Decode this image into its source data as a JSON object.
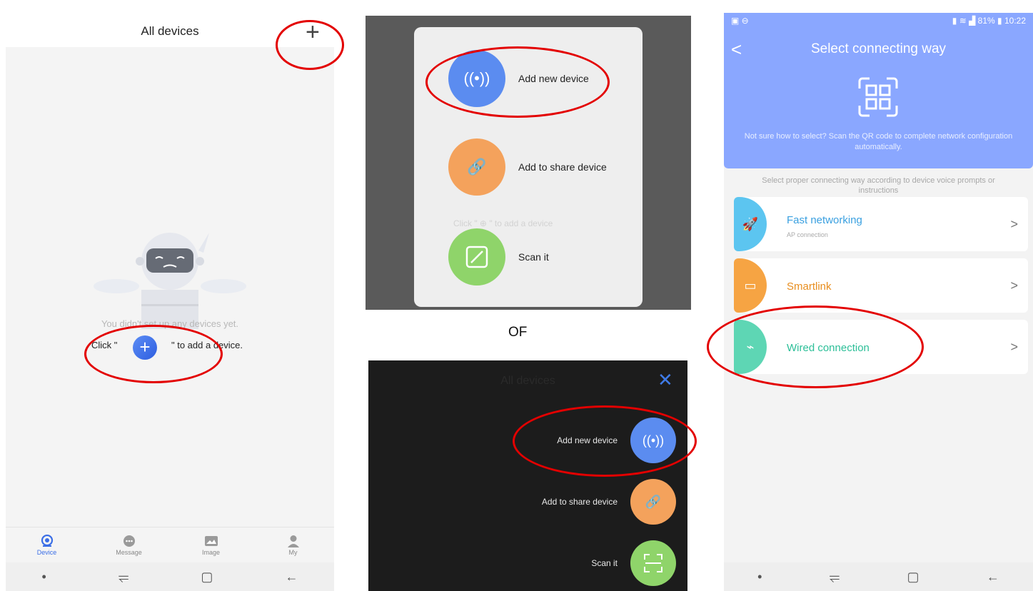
{
  "panel1": {
    "title": "All devices",
    "add_icon": "plus-icon",
    "empty_text": "You didn't set up any devices yet.",
    "click_prefix": "Click \"",
    "click_suffix": "\" to add a device.",
    "tabs": [
      {
        "label": "Device",
        "icon": "camera-icon",
        "active": true
      },
      {
        "label": "Message",
        "icon": "message-icon",
        "active": false
      },
      {
        "label": "Image",
        "icon": "image-icon",
        "active": false
      },
      {
        "label": "My",
        "icon": "user-icon",
        "active": false
      }
    ]
  },
  "panel2": {
    "options": [
      {
        "label": "Add new device",
        "icon": "wireless-icon",
        "color": "#5b8cf0"
      },
      {
        "label": "Add to share device",
        "icon": "link-icon",
        "color": "#f4a25c"
      },
      {
        "label": "Scan it",
        "icon": "scan-icon",
        "color": "#8fd46a"
      }
    ]
  },
  "of_label": "OF",
  "panel3": {
    "title": "All devices",
    "close_icon": "close-icon",
    "options": [
      {
        "label": "Add new device",
        "icon": "wireless-icon",
        "color": "#5b8cf0"
      },
      {
        "label": "Add to share device",
        "icon": "link-icon",
        "color": "#f4a25c"
      },
      {
        "label": "Scan it",
        "icon": "scan-icon",
        "color": "#8fd46a"
      }
    ]
  },
  "panel4": {
    "status_battery": "81%",
    "status_time": "10:22",
    "title": "Select connecting way",
    "hint": "Not sure how to select? Scan the QR code to complete network configuration automatically.",
    "sub": "Select proper connecting way according to device voice prompts or instructions",
    "cards": [
      {
        "name": "Fast networking",
        "sub": "AP connection",
        "color": "#5cc5f0",
        "text_color": "#3aa0e0",
        "icon": "rocket-icon"
      },
      {
        "name": "Smartlink",
        "sub": "",
        "color": "#f6a443",
        "text_color": "#e88e1f",
        "icon": "android-icon"
      },
      {
        "name": "Wired connection",
        "sub": "",
        "color": "#5ed6b4",
        "text_color": "#2cbf98",
        "icon": "plug-icon"
      }
    ]
  }
}
